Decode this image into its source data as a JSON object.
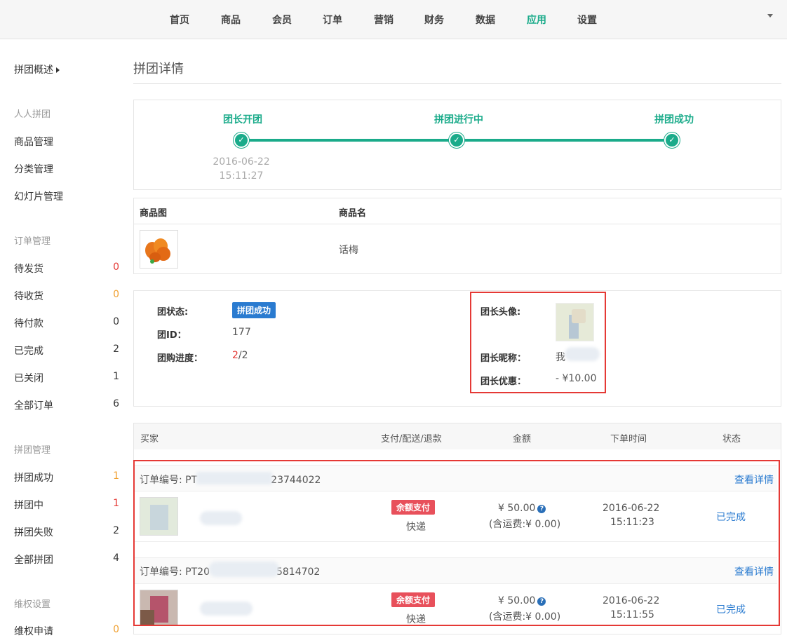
{
  "nav": {
    "items": [
      "首页",
      "商品",
      "会员",
      "订单",
      "营销",
      "财务",
      "数据",
      "应用",
      "设置"
    ],
    "active": "应用"
  },
  "sidebar": {
    "overview": "拼团概述",
    "groups": [
      {
        "title": "人人拼团",
        "items": [
          {
            "label": "商品管理",
            "count": ""
          },
          {
            "label": "分类管理",
            "count": ""
          },
          {
            "label": "幻灯片管理",
            "count": ""
          }
        ]
      },
      {
        "title": "订单管理",
        "items": [
          {
            "label": "待发货",
            "count": "0"
          },
          {
            "label": "待收货",
            "count": "0"
          },
          {
            "label": "待付款",
            "count": "0"
          },
          {
            "label": "已完成",
            "count": "2"
          },
          {
            "label": "已关闭",
            "count": "1"
          },
          {
            "label": "全部订单",
            "count": "6"
          }
        ]
      },
      {
        "title": "拼团管理",
        "items": [
          {
            "label": "拼团成功",
            "count": "1"
          },
          {
            "label": "拼团中",
            "count": "1"
          },
          {
            "label": "拼团失败",
            "count": "2"
          },
          {
            "label": "全部拼团",
            "count": "4"
          }
        ]
      },
      {
        "title": "维权设置",
        "items": [
          {
            "label": "维权申请",
            "count": "0"
          }
        ]
      }
    ],
    "colors": {
      "red": "#e53935",
      "orange": "#f0a030",
      "normal": "#333333"
    }
  },
  "page": {
    "title": "拼团详情"
  },
  "progress": {
    "steps": [
      "团长开团",
      "拼团进行中",
      "拼团成功"
    ],
    "start_date": "2016-06-22",
    "start_time": "15:11:27",
    "accent": "#1aab8a"
  },
  "product": {
    "headers": {
      "image": "商品图",
      "name": "商品名"
    },
    "name": "话梅"
  },
  "group": {
    "status_label": "团状态:",
    "status": "拼团成功",
    "id_label": "团ID：",
    "id": "177",
    "progress_label": "团购进度：",
    "progress_done": "2",
    "progress_total": "/2",
    "leader_avatar_label": "团长头像:",
    "leader_nick_label": "团长昵称：",
    "leader_nick": "我",
    "leader_discount_label": "团长优惠：",
    "leader_discount": "- ¥10.00"
  },
  "orders": {
    "headers": {
      "buyer": "买家",
      "pay": "支付/配送/退款",
      "amount": "金额",
      "time": "下单时间",
      "status": "状态"
    },
    "list": [
      {
        "order_no": "订单编号: PT",
        "order_no_tail": "23744022",
        "detail": "查看详情",
        "pay": "余额支付",
        "ship": "快递",
        "amount": "¥ 50.00",
        "freight": "(含运费:¥ 0.00)",
        "date": "2016-06-22",
        "time": "15:11:23",
        "status": "已完成"
      },
      {
        "order_no": "订单编号: PT20",
        "order_no_tail": "5814702",
        "detail": "查看详情",
        "pay": "余额支付",
        "ship": "快递",
        "amount": "¥ 50.00",
        "freight": "(含运费:¥ 0.00)",
        "date": "2016-06-22",
        "time": "15:11:55",
        "status": "已完成"
      }
    ]
  }
}
